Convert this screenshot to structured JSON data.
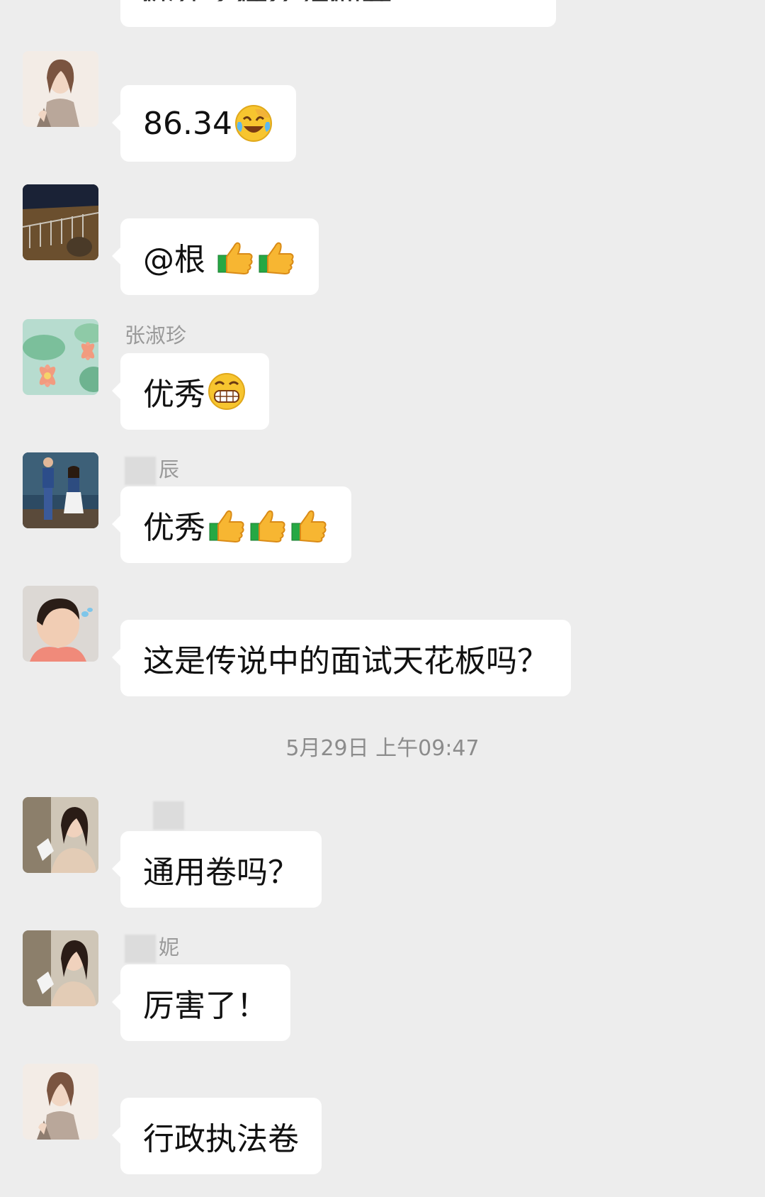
{
  "top_partial": {
    "text": "你在考什么神仙卷"
  },
  "messages": [
    {
      "sender": "",
      "text": "86.34",
      "emojis": [
        "laugh-cry-emoji"
      ],
      "avatar": "anime-character-avatar"
    },
    {
      "sender": "",
      "text": "@根 ",
      "emojis": [
        "thumbs-up-emoji",
        "thumbs-up-emoji"
      ],
      "avatar": "night-street-avatar"
    },
    {
      "sender": "张淑珍",
      "text": "优秀",
      "emojis": [
        "grin-emoji"
      ],
      "avatar": "lotus-avatar"
    },
    {
      "sender": "辰",
      "text": "优秀",
      "emojis": [
        "thumbs-up-emoji",
        "thumbs-up-emoji",
        "thumbs-up-emoji"
      ],
      "avatar": "couple-photo-avatar"
    },
    {
      "sender": "",
      "text": "这是传说中的面试天花板吗？",
      "emojis": [],
      "avatar": "child-avatar"
    },
    {
      "sender": "",
      "text": "通用卷吗？",
      "emojis": [],
      "avatar": "girl-photo-avatar"
    },
    {
      "sender": "妮",
      "text": "厉害了！",
      "emojis": [],
      "avatar": "girl-photo-avatar"
    },
    {
      "sender": "",
      "text": "行政执法卷",
      "emojis": [],
      "avatar": "anime-character-avatar"
    }
  ],
  "timestamp": "5月29日 上午09:47",
  "colors": {
    "background": "#ededed",
    "bubble": "#ffffff",
    "text": "#111111",
    "sender": "#9a9a9a"
  }
}
